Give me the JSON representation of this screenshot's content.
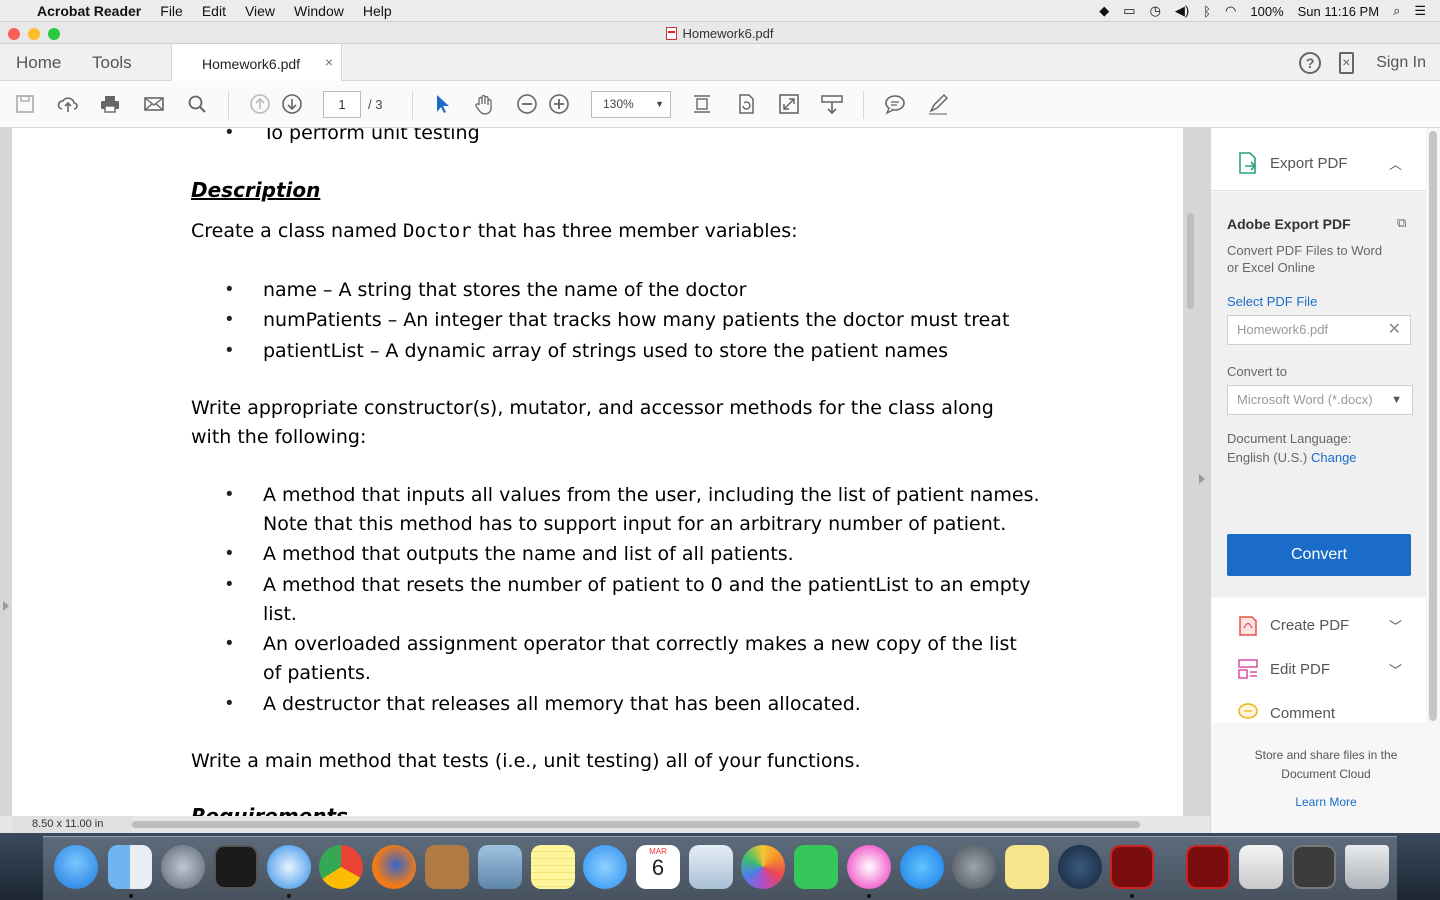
{
  "menubar": {
    "app_name": "Acrobat Reader",
    "menus": [
      "File",
      "Edit",
      "View",
      "Window",
      "Help"
    ],
    "battery": "100%",
    "clock": "Sun 11:16 PM"
  },
  "window": {
    "title": "Homework6.pdf"
  },
  "tabs": {
    "home": "Home",
    "tools": "Tools",
    "document": "Homework6.pdf",
    "close": "×",
    "sign_in": "Sign In",
    "help": "?"
  },
  "toolbar": {
    "page_current": "1",
    "page_total": "/ 3",
    "zoom": "130%"
  },
  "document": {
    "top_bullet": "To perform unit testing",
    "heading": "Description",
    "intro_pre": "Create a class named ",
    "intro_code": "Doctor",
    "intro_post": " that has three member variables:",
    "members": [
      "name – A string that stores the name of the doctor",
      "numPatients – An integer that tracks how many patients the doctor must treat",
      "patientList – A dynamic array of strings used to store the patient names"
    ],
    "para2_line1": "Write appropriate constructor(s), mutator, and accessor methods for the class along",
    "para2_line2": "with the following:",
    "methods": [
      [
        "A method that inputs all values from the user, including the list of patient names.",
        "Note that this method has to support input for an arbitrary number of patient."
      ],
      [
        "A method that outputs the name and list of all patients."
      ],
      [
        "A method that resets the number of patient to 0 and the patientList to an empty",
        "list."
      ],
      [
        "An overloaded assignment operator that correctly makes a new copy of the list",
        "of patients."
      ],
      [
        "A destructor that releases all memory that has been allocated."
      ]
    ],
    "closing": "Write a main method that tests (i.e., unit testing) all of your functions.",
    "next_heading": "Requirements"
  },
  "status": {
    "page_size": "8.50 x 11.00 in"
  },
  "right_panel": {
    "export_title": "Export PDF",
    "service_title": "Adobe Export PDF",
    "service_desc_1": "Convert PDF Files to Word",
    "service_desc_2": "or Excel Online",
    "select_file": "Select PDF File",
    "file_name": "Homework6.pdf",
    "convert_to_label": "Convert to",
    "convert_to_value": "Microsoft Word (*.docx)",
    "language_label": "Document Language:",
    "language_value": "English (U.S.)",
    "change": "Change",
    "convert_button": "Convert",
    "tools": [
      "Create PDF",
      "Edit PDF",
      "Comment"
    ],
    "cloud_1": "Store and share files in the",
    "cloud_2": "Document Cloud",
    "learn_more": "Learn More"
  },
  "colors": {
    "accent": "#1a6cc8",
    "dock_bg": "#2b3a4a"
  },
  "dock_icons": [
    "finder-icon",
    "launchpad-icon",
    "photo-booth-icon",
    "safari-icon",
    "chrome-icon",
    "firefox-icon",
    "contacts-icon",
    "preview-icon",
    "notes-icon",
    "messages-icon",
    "calendar-icon",
    "photos-viewer-icon",
    "photos-icon",
    "facetime-icon",
    "itunes-icon",
    "app-store-icon",
    "system-preferences-icon",
    "stickies-icon",
    "steam-icon",
    "acrobat-icon",
    "acrobat-icon",
    "jar-launcher-icon",
    "screenshot-icon",
    "trash-icon"
  ],
  "calendar": {
    "month": "MAR",
    "day": "6"
  }
}
